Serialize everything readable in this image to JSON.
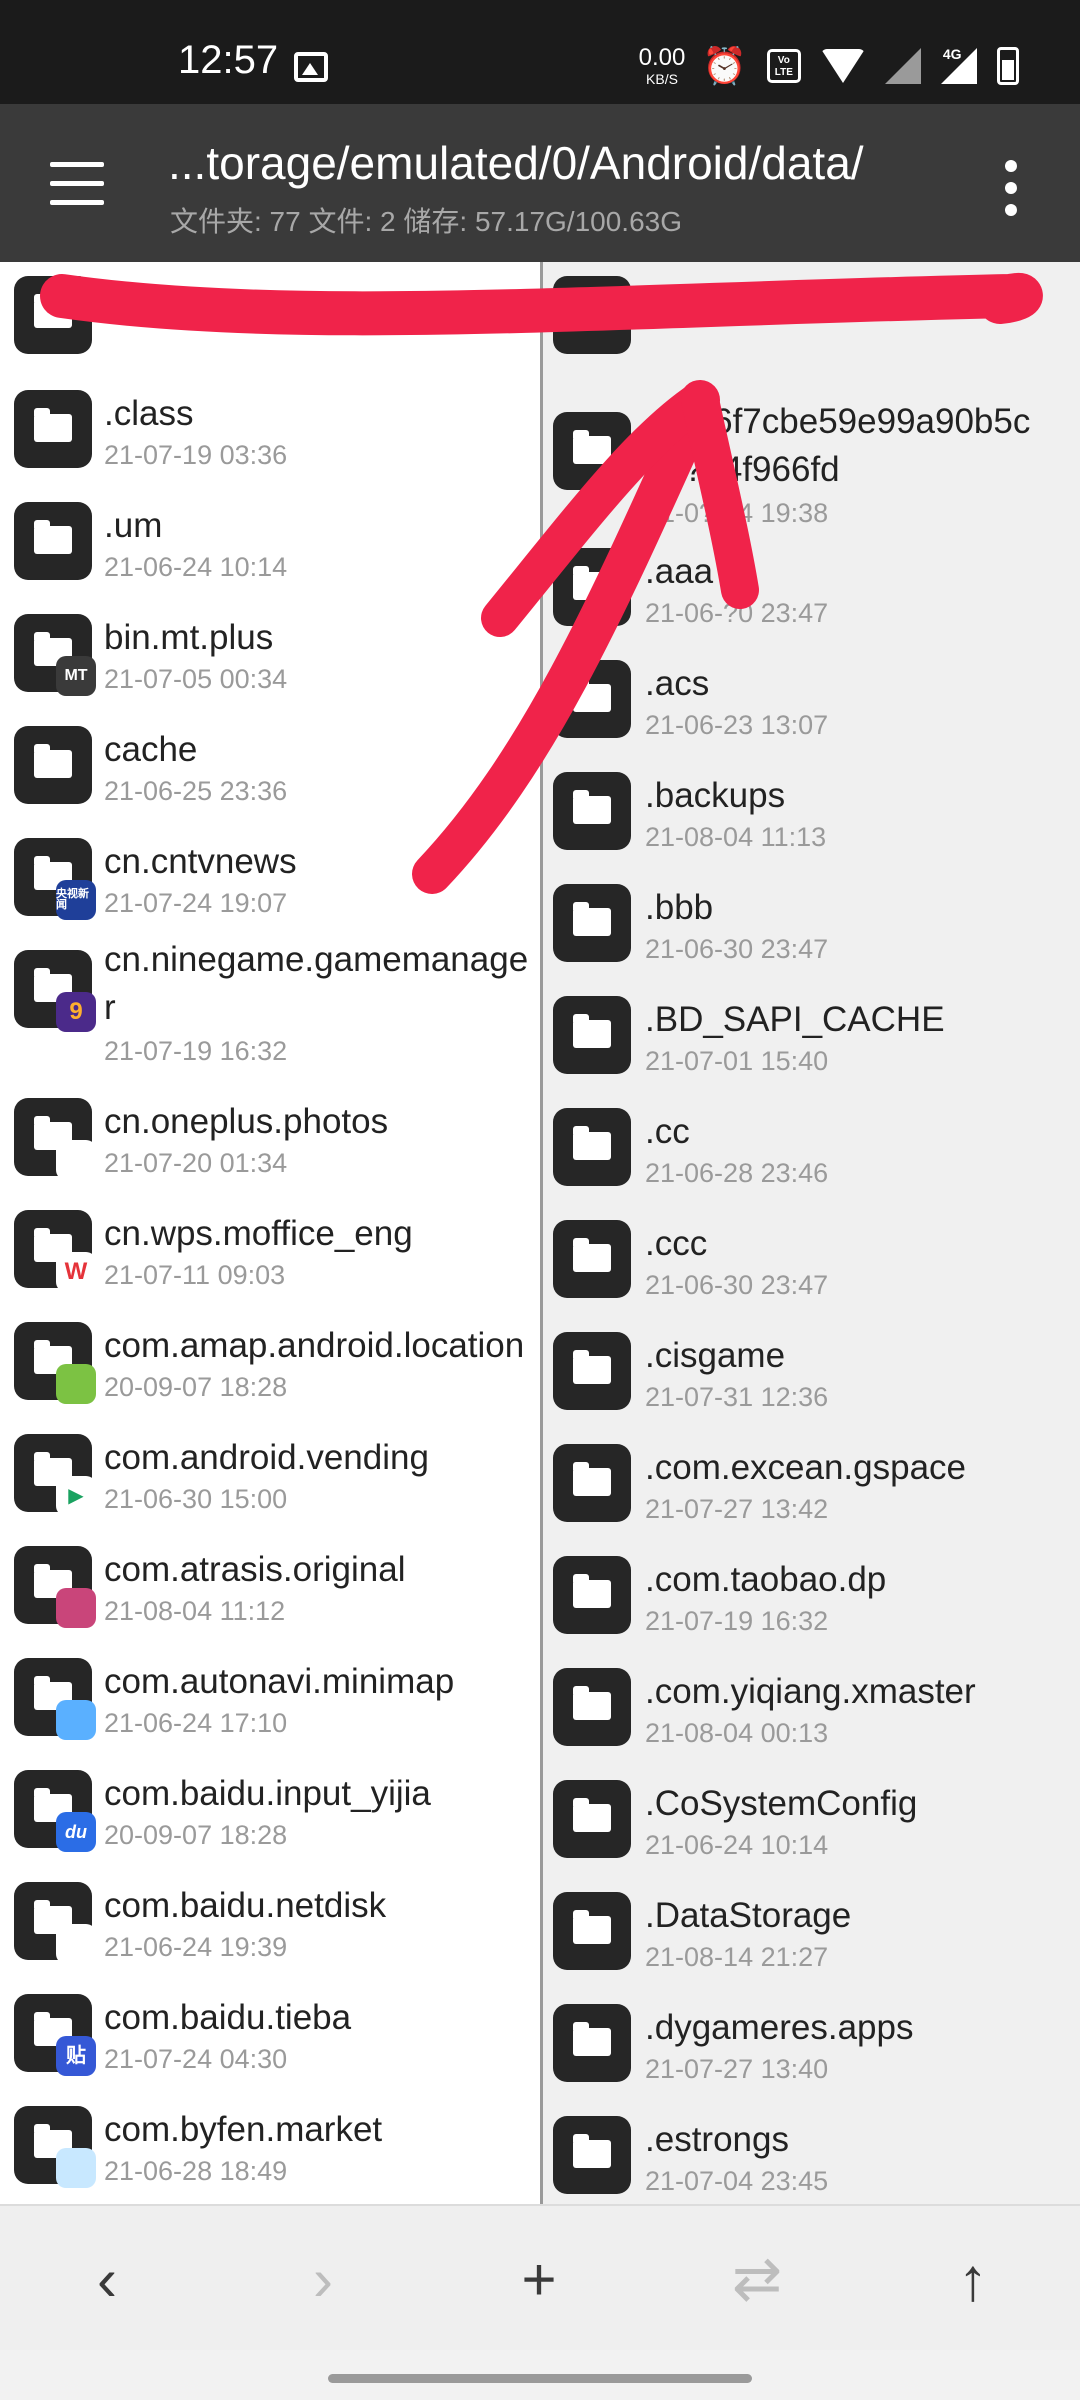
{
  "status_bar": {
    "time": "12:57",
    "net_speed_value": "0.00",
    "net_speed_unit": "KB/S",
    "volte_label": "Vo LTE",
    "network_label": "4G",
    "icons": [
      "gallery-icon",
      "alarm-icon",
      "volte-icon",
      "wifi-icon",
      "no-signal-icon",
      "signal-4g-icon",
      "battery-icon"
    ]
  },
  "app_bar": {
    "path": "...torage/emulated/0/Android/data/",
    "summary": "文件夹: 77  文件: 2  储存: 57.17G/100.63G"
  },
  "left_pane": {
    "items": [
      {
        "name": "",
        "date": "",
        "badge": ""
      },
      {
        "name": ".class",
        "date": "21-07-19 03:36",
        "badge": ""
      },
      {
        "name": ".um",
        "date": "21-06-24 10:14",
        "badge": ""
      },
      {
        "name": "bin.mt.plus",
        "date": "21-07-05 00:34",
        "badge": "MT"
      },
      {
        "name": "cache",
        "date": "21-06-25 23:36",
        "badge": ""
      },
      {
        "name": "cn.cntvnews",
        "date": "21-07-24 19:07",
        "badge": "央视新闻"
      },
      {
        "name": "cn.ninegame.gamemanager",
        "date": "21-07-19 16:32",
        "badge": "9"
      },
      {
        "name": "cn.oneplus.photos",
        "date": "21-07-20 01:34",
        "badge": ""
      },
      {
        "name": "cn.wps.moffice_eng",
        "date": "21-07-11 09:03",
        "badge": "W"
      },
      {
        "name": "com.amap.android.location",
        "date": "20-09-07 18:28",
        "badge": ""
      },
      {
        "name": "com.android.vending",
        "date": "21-06-30 15:00",
        "badge": "▶"
      },
      {
        "name": "com.atrasis.original",
        "date": "21-08-04 11:12",
        "badge": ""
      },
      {
        "name": "com.autonavi.minimap",
        "date": "21-06-24 17:10",
        "badge": ""
      },
      {
        "name": "com.baidu.input_yijia",
        "date": "20-09-07 18:28",
        "badge": "du"
      },
      {
        "name": "com.baidu.netdisk",
        "date": "21-06-24 19:39",
        "badge": ""
      },
      {
        "name": "com.baidu.tieba",
        "date": "21-07-24 04:30",
        "badge": "贴"
      },
      {
        "name": "com.byfen.market",
        "date": "21-06-28 18:49",
        "badge": ""
      }
    ]
  },
  "right_pane": {
    "items": [
      {
        "name": "",
        "date": ""
      },
      {
        "name": ".62?6f7cbe59e99a90b5ce??94f966fd",
        "date": "21-0?-24 19:38"
      },
      {
        "name": ".aaa",
        "date": "21-06-?0 23:47"
      },
      {
        "name": ".acs",
        "date": "21-06-23 13:07"
      },
      {
        "name": ".backups",
        "date": "21-08-04 11:13"
      },
      {
        "name": ".bbb",
        "date": "21-06-30 23:47"
      },
      {
        "name": ".BD_SAPI_CACHE",
        "date": "21-07-01 15:40"
      },
      {
        "name": ".cc",
        "date": "21-06-28 23:46"
      },
      {
        "name": ".ccc",
        "date": "21-06-30 23:47"
      },
      {
        "name": ".cisgame",
        "date": "21-07-31 12:36"
      },
      {
        "name": ".com.excean.gspace",
        "date": "21-07-27 13:42"
      },
      {
        "name": ".com.taobao.dp",
        "date": "21-07-19 16:32"
      },
      {
        "name": ".com.yiqiang.xmaster",
        "date": "21-08-04 00:13"
      },
      {
        "name": ".CoSystemConfig",
        "date": "21-06-24 10:14"
      },
      {
        "name": ".DataStorage",
        "date": "21-08-14 21:27"
      },
      {
        "name": ".dygameres.apps",
        "date": "21-07-27 13:40"
      },
      {
        "name": ".estrongs",
        "date": "21-07-04 23:45"
      }
    ]
  },
  "bottom_bar": {
    "back": "‹",
    "forward": "›",
    "add": "+",
    "swap": "⇄",
    "up": "↑"
  },
  "colors": {
    "app_bar": "#3a3a3a",
    "status_bar": "#1b1b1b",
    "annotation_red": "#f0234a",
    "folder_icon": "#262626"
  }
}
